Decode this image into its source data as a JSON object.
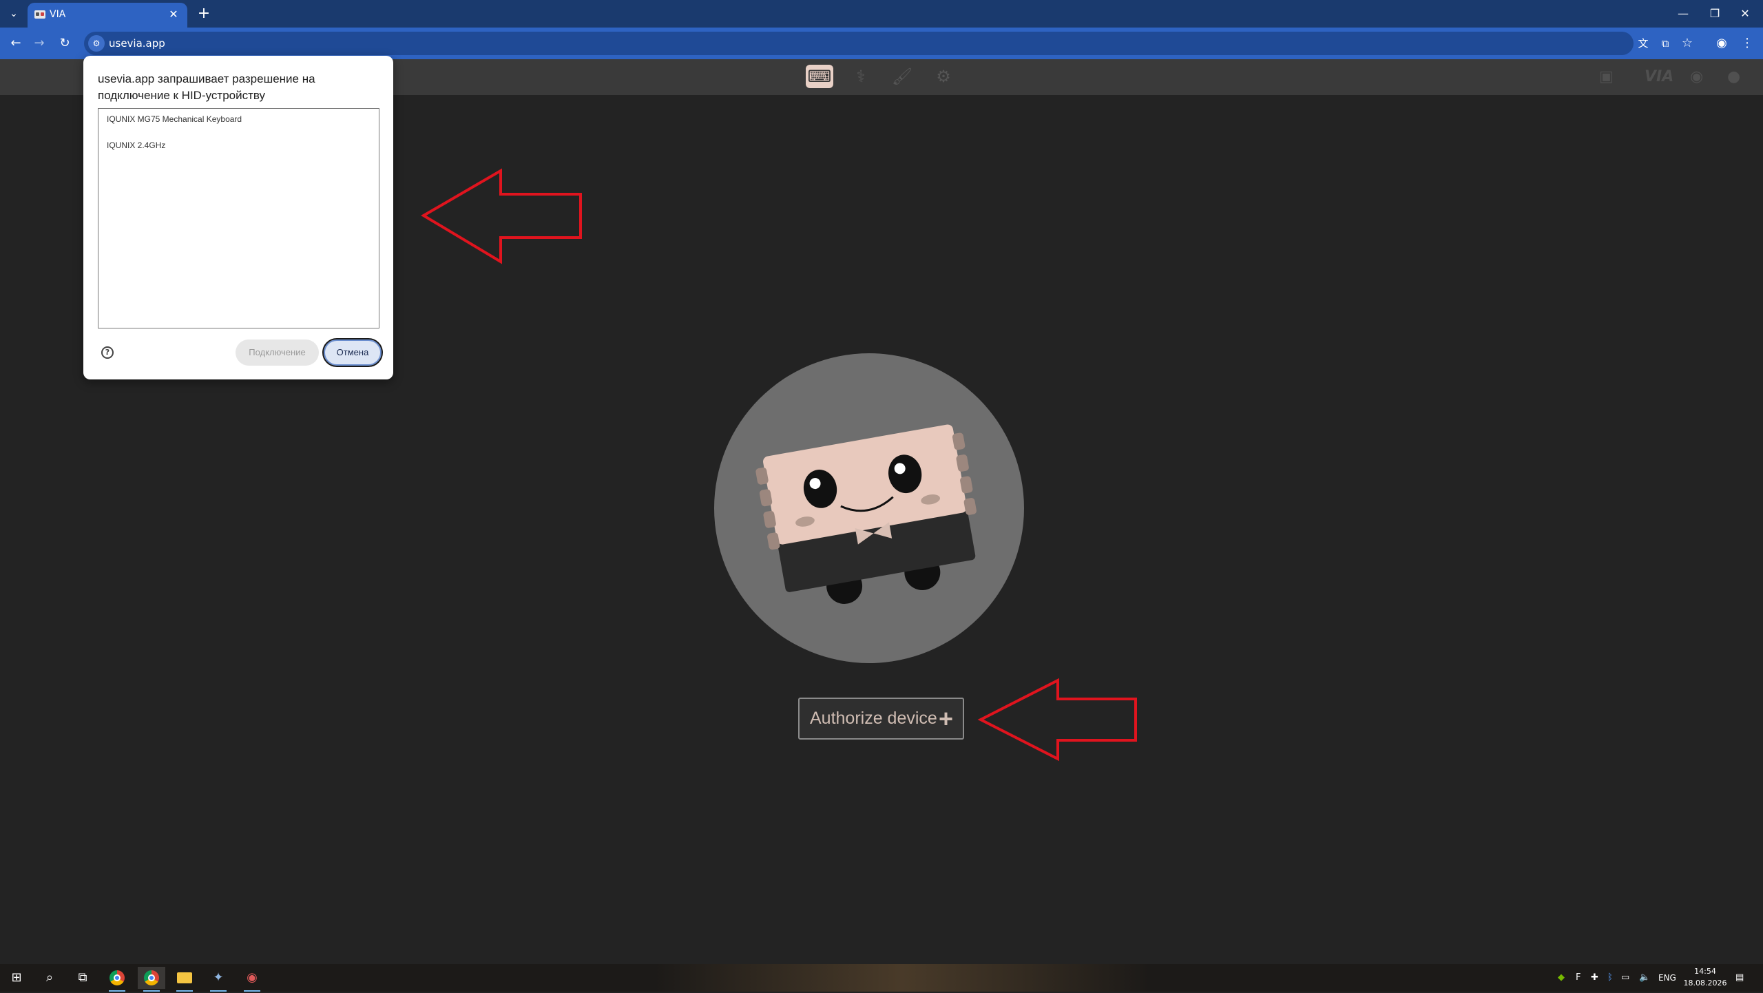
{
  "browser": {
    "tab_title": "VIA",
    "url": "usevia.app",
    "new_tab": "+",
    "tab_close": "✕",
    "window": {
      "minimize": "—",
      "restore": "❐",
      "close": "✕"
    }
  },
  "dialog": {
    "title": "usevia.app запрашивает разрешение на подключение к HID-устройству",
    "devices": [
      "IQUNIX MG75 Mechanical Keyboard",
      "IQUNIX 2.4GHz"
    ],
    "connect_label": "Подключение",
    "cancel_label": "Отмена",
    "help": "?"
  },
  "app": {
    "header_tabs": [
      "keyboard-icon",
      "test-icon",
      "design-icon",
      "settings-icon"
    ],
    "header_right": {
      "logo": "VIA"
    },
    "authorize_label": "Authorize device",
    "authorize_plus": "+"
  },
  "taskbar": {
    "language": "ENG",
    "time": "14:54",
    "date": "18.08.2026"
  },
  "colors": {
    "chrome_blue": "#2e63c2",
    "app_bg": "#232323",
    "mascot_circle": "#6e6e6e",
    "authorize_text": "#d0bdb3",
    "arrow_red": "#e0141e"
  }
}
